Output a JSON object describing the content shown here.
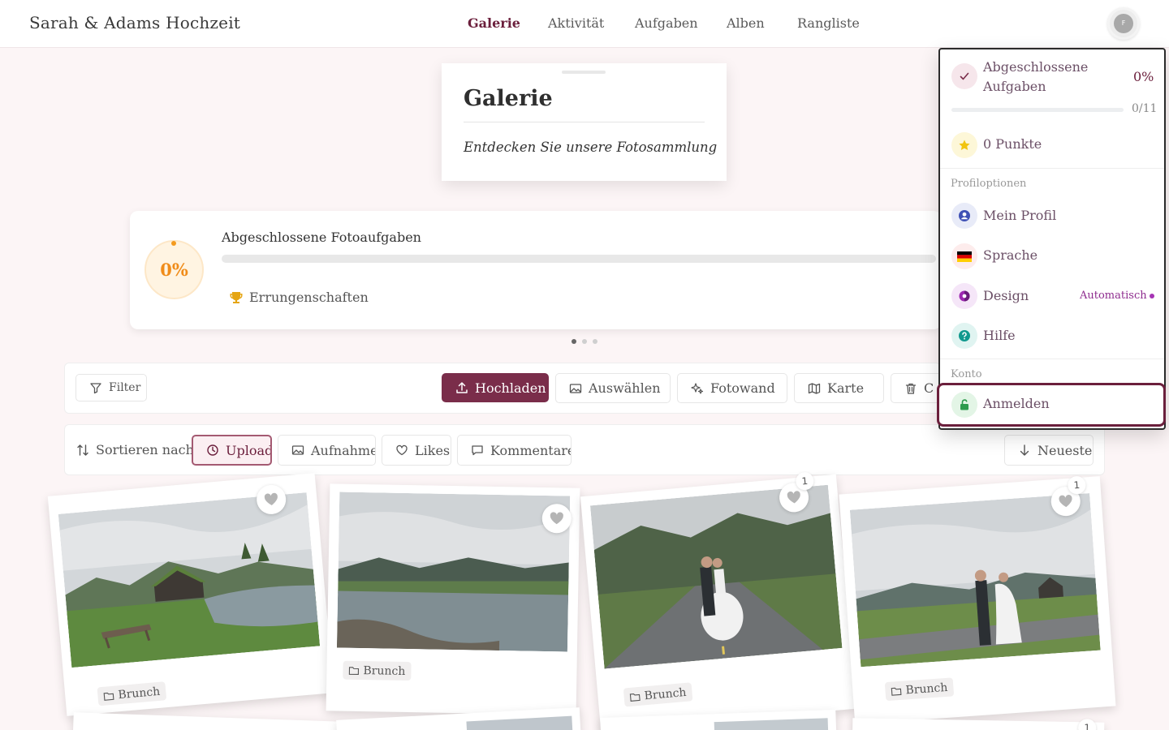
{
  "header": {
    "brand": "Sarah & Adams Hochzeit",
    "nav": [
      {
        "label": "Galerie",
        "active": true
      },
      {
        "label": "Aktivität",
        "active": false
      },
      {
        "label": "Aufgaben",
        "active": false
      },
      {
        "label": "Alben",
        "active": false
      },
      {
        "label": "Rangliste",
        "active": false
      }
    ],
    "avatar_initial": "F"
  },
  "gallery_card": {
    "title": "Galerie",
    "subtitle": "Entdecken Sie unsere Fotosammlung"
  },
  "progress_card": {
    "percent_label": "0%",
    "progress_fraction": 0,
    "label": "Abgeschlossene Fotoaufgaben",
    "achievements": "Errungenschaften",
    "carousel_pages": 3,
    "carousel_active": 0
  },
  "toolbar": {
    "filter": "Filter",
    "upload": "Hochladen",
    "select": "Auswählen",
    "photowall": "Fotowand",
    "map": "Karte",
    "cut_label": "C"
  },
  "sort": {
    "label": "Sortieren nach",
    "options": [
      {
        "label": "Upload",
        "selected": true
      },
      {
        "label": "Aufnahme",
        "selected": false
      },
      {
        "label": "Likes",
        "selected": false
      },
      {
        "label": "Kommentare",
        "selected": false
      }
    ],
    "order": "Neueste"
  },
  "photos": [
    {
      "tag": "Brunch",
      "likes": ""
    },
    {
      "tag": "Brunch",
      "likes": ""
    },
    {
      "tag": "Brunch",
      "likes": "1"
    },
    {
      "tag": "Brunch",
      "likes": "1"
    }
  ],
  "second_row_badge": "1",
  "dropdown": {
    "tasks_label": "Abgeschlossene Aufgaben",
    "tasks_percent": "0%",
    "tasks_count": "0/11",
    "tasks_fraction": 0,
    "points": "0 Punkte",
    "section_profile": "Profiloptionen",
    "my_profile": "Mein Profil",
    "language": "Sprache",
    "design": "Design",
    "design_value": "Automatisch",
    "help": "Hilfe",
    "section_account": "Konto",
    "login": "Anmelden"
  },
  "colors": {
    "accent": "#7a2d4a",
    "accent_dark": "#6b1f3c",
    "progress_orange": "#f08c1a",
    "background": "#fcf5f6"
  }
}
